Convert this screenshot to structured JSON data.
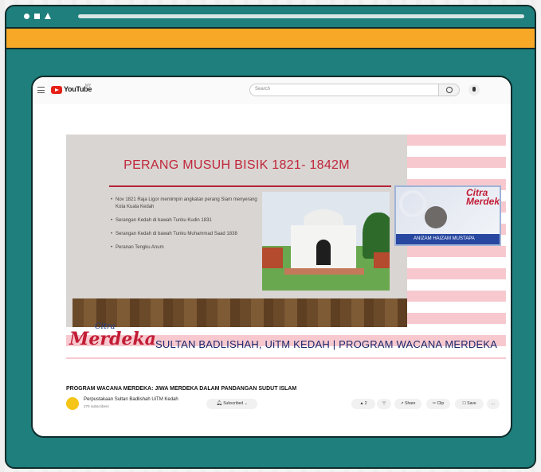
{
  "window": {
    "accent": "#f7a826",
    "frame": "#1e7f7c"
  },
  "youtube": {
    "logo_text": "YouTube",
    "logo_sup": "MY",
    "search_placeholder": "Search"
  },
  "slide": {
    "title": "PERANG MUSUH BISIK 1821- 1842M",
    "bullets": [
      "Nov 1821 Raja Ligor memimpin angkatan perang Siam menyerang Kota Kuala Kedah",
      "Serangan Kedah di bawah Tunku Kudin 1831",
      "Serangan Kedah di bawah Tunku Muhammad Saad 1838",
      "Peranan Tengku Anum"
    ]
  },
  "pip": {
    "caption": "ANIZAM HAIZAM MUSTAPA",
    "logo_text": "Citra Merdeka"
  },
  "banner": {
    "logo_small": "Citra",
    "logo_big": "Merdeka",
    "text": "SULTAN BADLISHAH, UiTM KEDAH | PROGRAM WACANA MERDEKA"
  },
  "video": {
    "title": "PROGRAM WACANA MERDEKA: JIWA MERDEKA DALAM PANDANGAN SUDUT ISLAM",
    "channel": "Perpustakaan Sultan Badlishah UiTM Kedah",
    "subscribers": "270 subscribers",
    "subscribe_label": "Subscribed",
    "like_count": "2",
    "share_label": "Share",
    "clip_label": "Clip",
    "save_label": "Save",
    "more_label": "..."
  }
}
